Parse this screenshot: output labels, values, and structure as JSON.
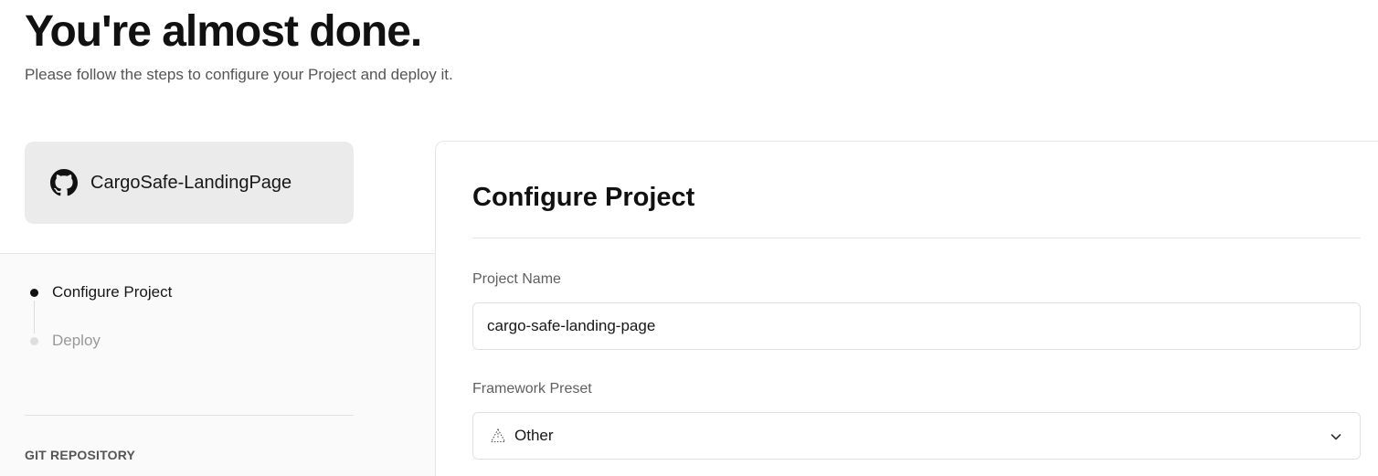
{
  "header": {
    "title": "You're almost done.",
    "subtitle": "Please follow the steps to configure your Project and deploy it."
  },
  "repo": {
    "icon": "github-icon",
    "name": "CargoSafe-LandingPage"
  },
  "steps": [
    {
      "label": "Configure Project",
      "state": "active"
    },
    {
      "label": "Deploy",
      "state": "inactive"
    }
  ],
  "git_section_label": "GIT REPOSITORY",
  "configure": {
    "title": "Configure Project",
    "project_name": {
      "label": "Project Name",
      "value": "cargo-safe-landing-page"
    },
    "framework": {
      "label": "Framework Preset",
      "selected": "Other",
      "icon": "triangle-preset-icon"
    }
  },
  "colors": {
    "active_dot": "#111111",
    "inactive_dot": "#dedede",
    "card_bg": "#ebebeb",
    "panel_bg": "#fafafa"
  }
}
